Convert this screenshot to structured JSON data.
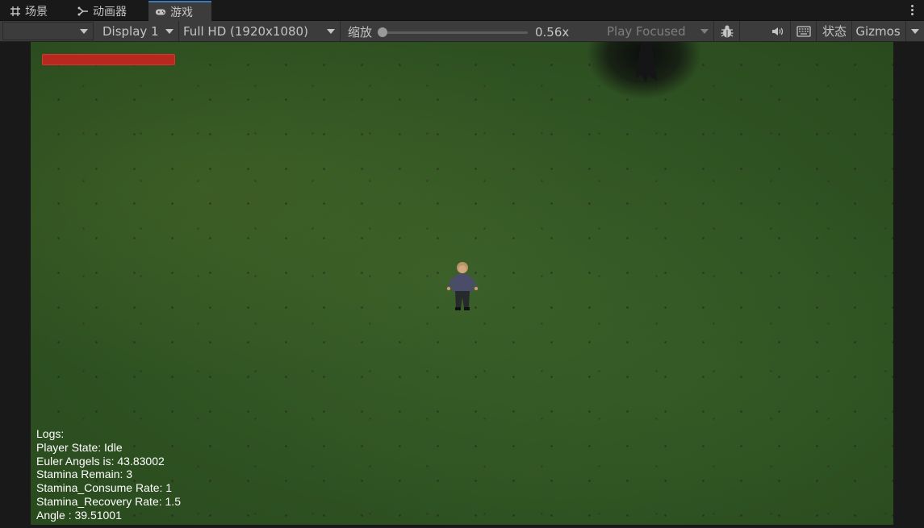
{
  "tabs": [
    {
      "label": "场景",
      "icon": "grid-icon",
      "active": false
    },
    {
      "label": "动画器",
      "icon": "animator-icon",
      "active": false
    },
    {
      "label": "游戏",
      "icon": "gamepad-icon",
      "active": true
    }
  ],
  "toolbar": {
    "display": "Display 1",
    "resolution": "Full HD (1920x1080)",
    "scale_label": "缩放",
    "scale_value": "0.56x",
    "play_mode": "Play Focused",
    "stats_label": "状态",
    "gizmos_label": "Gizmos"
  },
  "game": {
    "health_fraction": 1.0,
    "logs": [
      "Logs:",
      "Player State: Idle",
      "Euler Angels is: 43.83002",
      "Stamina Remain: 3",
      "Stamina_Consume Rate: 1",
      "Stamina_Recovery Rate: 1.5",
      "Angle : 39.51001"
    ]
  },
  "colors": {
    "tab_accent": "#3a79bb",
    "health": "#b8281f",
    "grass": "#2f5222"
  }
}
